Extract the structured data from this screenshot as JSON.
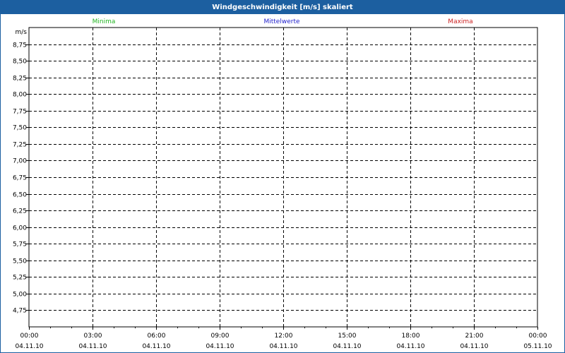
{
  "chart_data": {
    "type": "line",
    "title": "Windgeschwindigkeit [m/s] skaliert",
    "ylabel": "m/s",
    "ylim": [
      4.5,
      9.0
    ],
    "yticks": [
      "8,75",
      "8,50",
      "8,25",
      "8,00",
      "7,75",
      "7,50",
      "7,25",
      "7,00",
      "6,75",
      "6,50",
      "6,25",
      "6,00",
      "5,75",
      "5,50",
      "5,25",
      "5,00",
      "4,75"
    ],
    "yticks_values": [
      8.75,
      8.5,
      8.25,
      8.0,
      7.75,
      7.5,
      7.25,
      7.0,
      6.75,
      6.5,
      6.25,
      6.0,
      5.75,
      5.5,
      5.25,
      5.0,
      4.75
    ],
    "xticks": [
      {
        "time": "00:00",
        "date": "04.11.10"
      },
      {
        "time": "03:00",
        "date": "04.11.10"
      },
      {
        "time": "06:00",
        "date": "04.11.10"
      },
      {
        "time": "09:00",
        "date": "04.11.10"
      },
      {
        "time": "12:00",
        "date": "04.11.10"
      },
      {
        "time": "15:00",
        "date": "04.11.10"
      },
      {
        "time": "18:00",
        "date": "04.11.10"
      },
      {
        "time": "21:00",
        "date": "04.11.10"
      },
      {
        "time": "00:00",
        "date": "05.11.10"
      }
    ],
    "series": [
      {
        "name": "Minima",
        "color": "#22b522",
        "values": []
      },
      {
        "name": "Mittelwerte",
        "color": "#2222cc",
        "values": []
      },
      {
        "name": "Maxima",
        "color": "#cc2222",
        "values": []
      }
    ],
    "grid": true
  }
}
